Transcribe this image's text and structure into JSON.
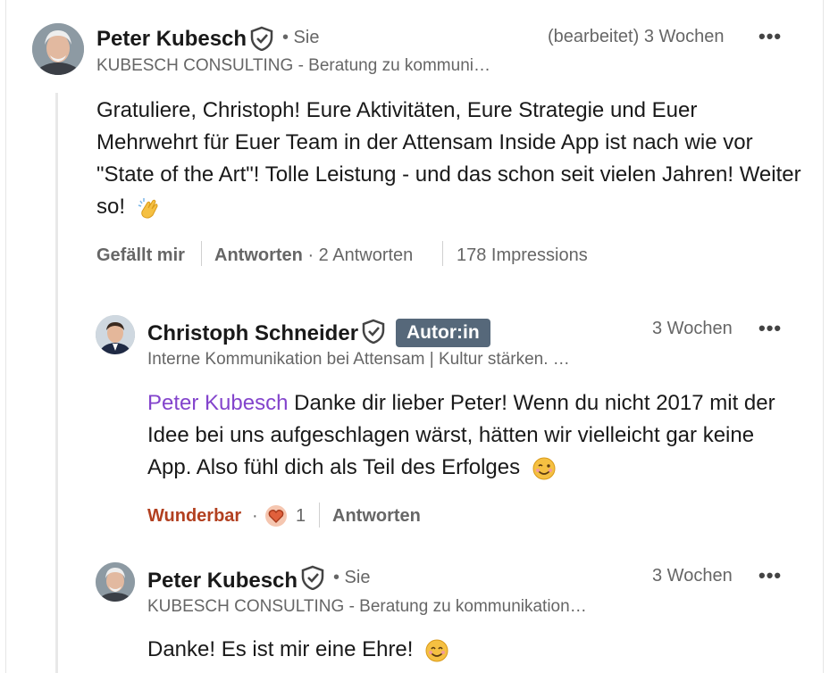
{
  "comment1": {
    "author": "Peter Kubesch",
    "you_label": "• Sie",
    "subtitle": "KUBESCH CONSULTING - Beratung zu kommuni…",
    "meta": "(bearbeitet) 3 Wochen",
    "more": "•••",
    "text": "Gratuliere, Christoph! Eure Aktivitäten, Eure Strategie und Euer Mehrwehrt für Euer Team in der Attensam Inside App ist nach wie vor \"State of the Art\"! Tolle Leistung - und das schon seit vielen Jahren! Weiter so!",
    "emoji": "clapping-hands",
    "actions": {
      "like": "Gefällt mir",
      "reply": "Antworten",
      "replies_count": "· 2 Antworten",
      "impressions": "178 Impressions"
    }
  },
  "reply1": {
    "author": "Christoph Schneider",
    "badge": "Autor:in",
    "subtitle": "Interne Kommunikation bei Attensam | Kultur stärken. …",
    "meta": "3 Wochen",
    "more": "•••",
    "mention": "Peter Kubesch",
    "text": " Danke dir lieber Peter! Wenn du nicht 2017 mit der Idee bei uns aufgeschlagen wärst, hätten wir vielleicht gar keine App. Also fühl dich als Teil des Erfolges",
    "emoji": "winking-face",
    "actions": {
      "reaction": "Wunderbar",
      "reaction_sep": "·",
      "reaction_count": "1",
      "reply": "Antworten"
    },
    "reaction_color": "#b24020"
  },
  "reply2": {
    "author": "Peter Kubesch",
    "you_label": "• Sie",
    "subtitle": "KUBESCH CONSULTING - Beratung zu kommunikation…",
    "meta": "3 Wochen",
    "more": "•••",
    "text": "Danke! Es ist mir eine Ehre!",
    "emoji": "smiling-face"
  }
}
